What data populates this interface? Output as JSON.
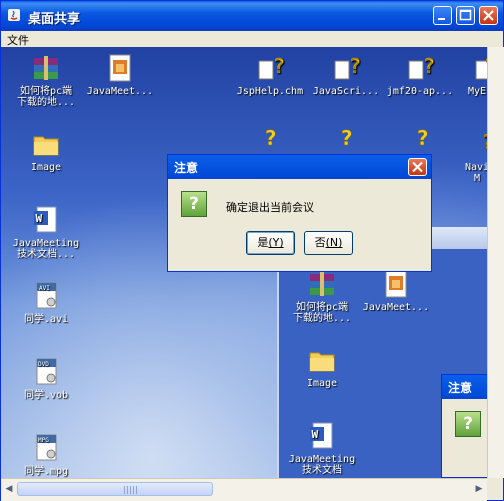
{
  "window": {
    "title": "桌面共享"
  },
  "menu": {
    "file_label": "文件"
  },
  "desktop_icons": [
    {
      "label": "如何将pc端\n下载的地...",
      "icon": "winrar-archive-icon"
    },
    {
      "label": "JavaMeet...",
      "icon": "image-document-icon"
    },
    {
      "label": "JspHelp.chm",
      "icon": "help-file-icon"
    },
    {
      "label": "JavaScri...",
      "icon": "help-file-icon"
    },
    {
      "label": "jmf20-ap...",
      "icon": "help-file-icon"
    },
    {
      "label": "MyE",
      "icon": "help-file-icon"
    },
    {
      "label": "Image",
      "icon": "folder-icon"
    },
    {
      "label": "Navi\nM",
      "icon": "help-file-icon"
    },
    {
      "label": "JavaMeeting\n技术文档...",
      "icon": "word-document-icon"
    },
    {
      "label": "同学.avi",
      "icon": "avi-file-icon"
    },
    {
      "label": "同学.vob",
      "icon": "vob-file-icon"
    },
    {
      "label": "同学.mpg",
      "icon": "mpg-file-icon"
    }
  ],
  "inner_icons": [
    {
      "label": "如何将pc端\n下载的地...",
      "icon": "winrar-archive-icon"
    },
    {
      "label": "JavaMeet...",
      "icon": "image-document-icon"
    },
    {
      "label": "Image",
      "icon": "folder-icon"
    },
    {
      "label": "JavaMeeting\n技术文档",
      "icon": "word-document-icon"
    }
  ],
  "dialog": {
    "title": "注意",
    "message": "确定退出当前会议",
    "yes_text": "是",
    "yes_key": "(Y)",
    "no_text": "否",
    "no_key": "(N)",
    "icon": "question-icon",
    "icon_glyph": "?"
  },
  "mini_dialog": {
    "title": "注意",
    "icon_glyph": "?"
  },
  "colors": {
    "titlebar": "#0046d5",
    "dialog_bg": "#ece9d8",
    "close_button": "#c73510"
  }
}
